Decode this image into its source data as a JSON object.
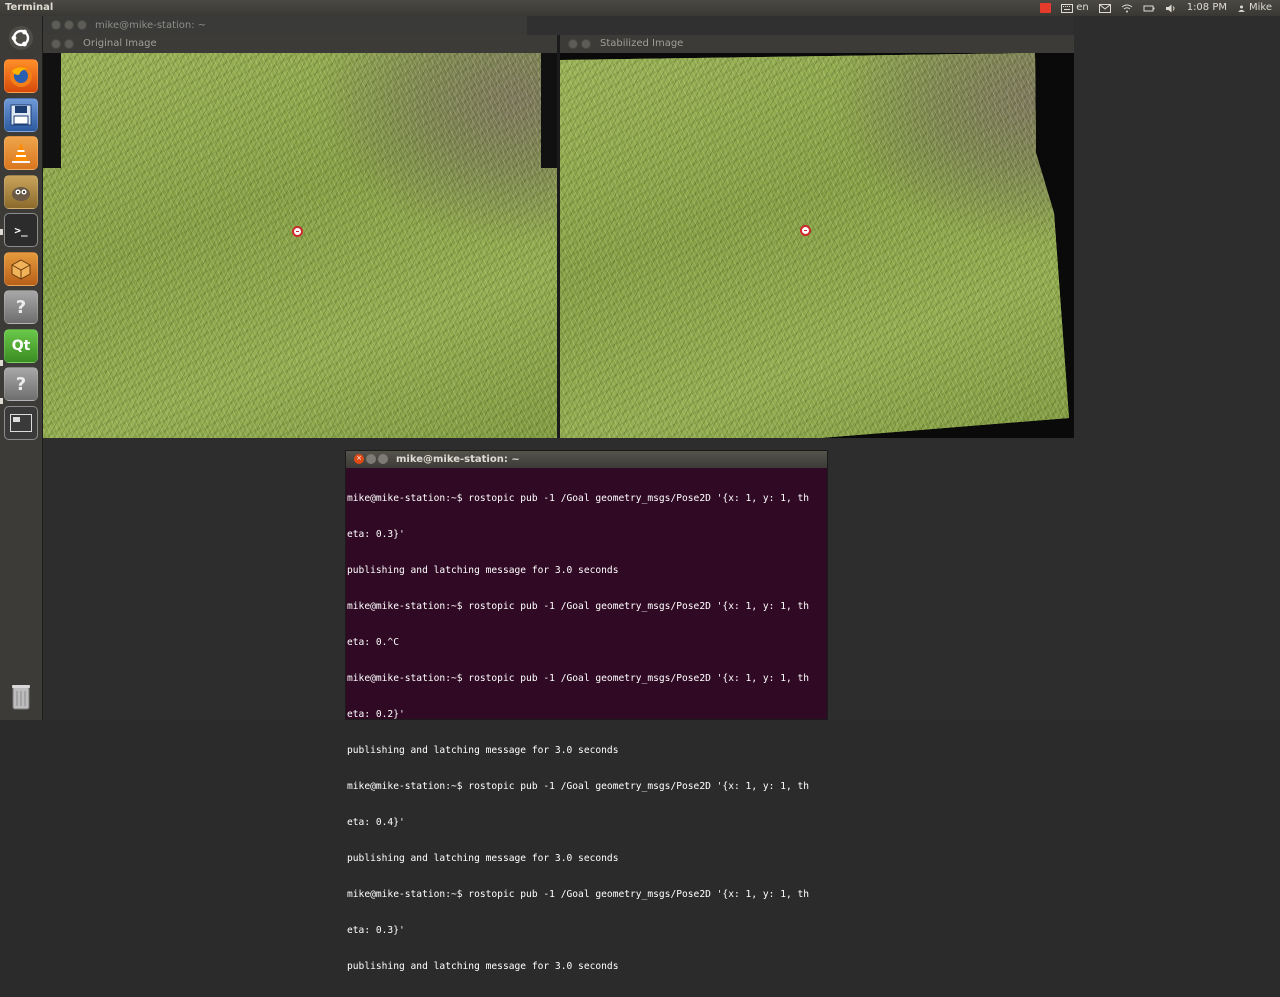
{
  "top_panel": {
    "app_title": "Terminal",
    "keyboard_lang": "en",
    "time": "1:08 PM",
    "user": "Mike"
  },
  "launcher": {
    "items": [
      {
        "name": "dash-home",
        "icon": "ubuntu-logo-icon"
      },
      {
        "name": "firefox",
        "icon": "firefox-icon"
      },
      {
        "name": "save-app",
        "icon": "floppy-icon"
      },
      {
        "name": "vlc",
        "icon": "vlc-cone-icon"
      },
      {
        "name": "gimp",
        "icon": "gimp-icon"
      },
      {
        "name": "terminal",
        "icon": "terminal-icon",
        "label": ">_"
      },
      {
        "name": "box-app",
        "icon": "box-icon"
      },
      {
        "name": "unknown-app-1",
        "icon": "question-icon",
        "label": "?"
      },
      {
        "name": "qt-creator",
        "icon": "qt-icon",
        "label": "Qt"
      },
      {
        "name": "unknown-app-2",
        "icon": "question-icon",
        "label": "?"
      },
      {
        "name": "workspace-switcher",
        "icon": "workspaces-icon"
      },
      {
        "name": "trash",
        "icon": "trash-icon"
      }
    ]
  },
  "bg_window": {
    "title": "mike@mike-station: ~"
  },
  "windows": {
    "original": {
      "title": "Original Image"
    },
    "stabilized": {
      "title": "Stabilized Image"
    }
  },
  "terminal": {
    "title": "mike@mike-station: ~",
    "lines": [
      "mike@mike-station:~$ rostopic pub -1 /Goal geometry_msgs/Pose2D '{x: 1, y: 1, th",
      "eta: 0.3}'",
      "publishing and latching message for 3.0 seconds",
      "mike@mike-station:~$ rostopic pub -1 /Goal geometry_msgs/Pose2D '{x: 1, y: 1, th",
      "eta: 0.^C",
      "mike@mike-station:~$ rostopic pub -1 /Goal geometry_msgs/Pose2D '{x: 1, y: 1, th",
      "eta: 0.2}'",
      "publishing and latching message for 3.0 seconds",
      "mike@mike-station:~$ rostopic pub -1 /Goal geometry_msgs/Pose2D '{x: 1, y: 1, th",
      "eta: 0.4}'",
      "publishing and latching message for 3.0 seconds",
      "mike@mike-station:~$ rostopic pub -1 /Goal geometry_msgs/Pose2D '{x: 1, y: 1, th",
      "eta: 0.3}'",
      "publishing and latching message for 3.0 seconds"
    ]
  },
  "colors": {
    "terminal_bg": "#300a24",
    "panel_bg": "#3c3b37",
    "close_button": "#df4a16"
  }
}
